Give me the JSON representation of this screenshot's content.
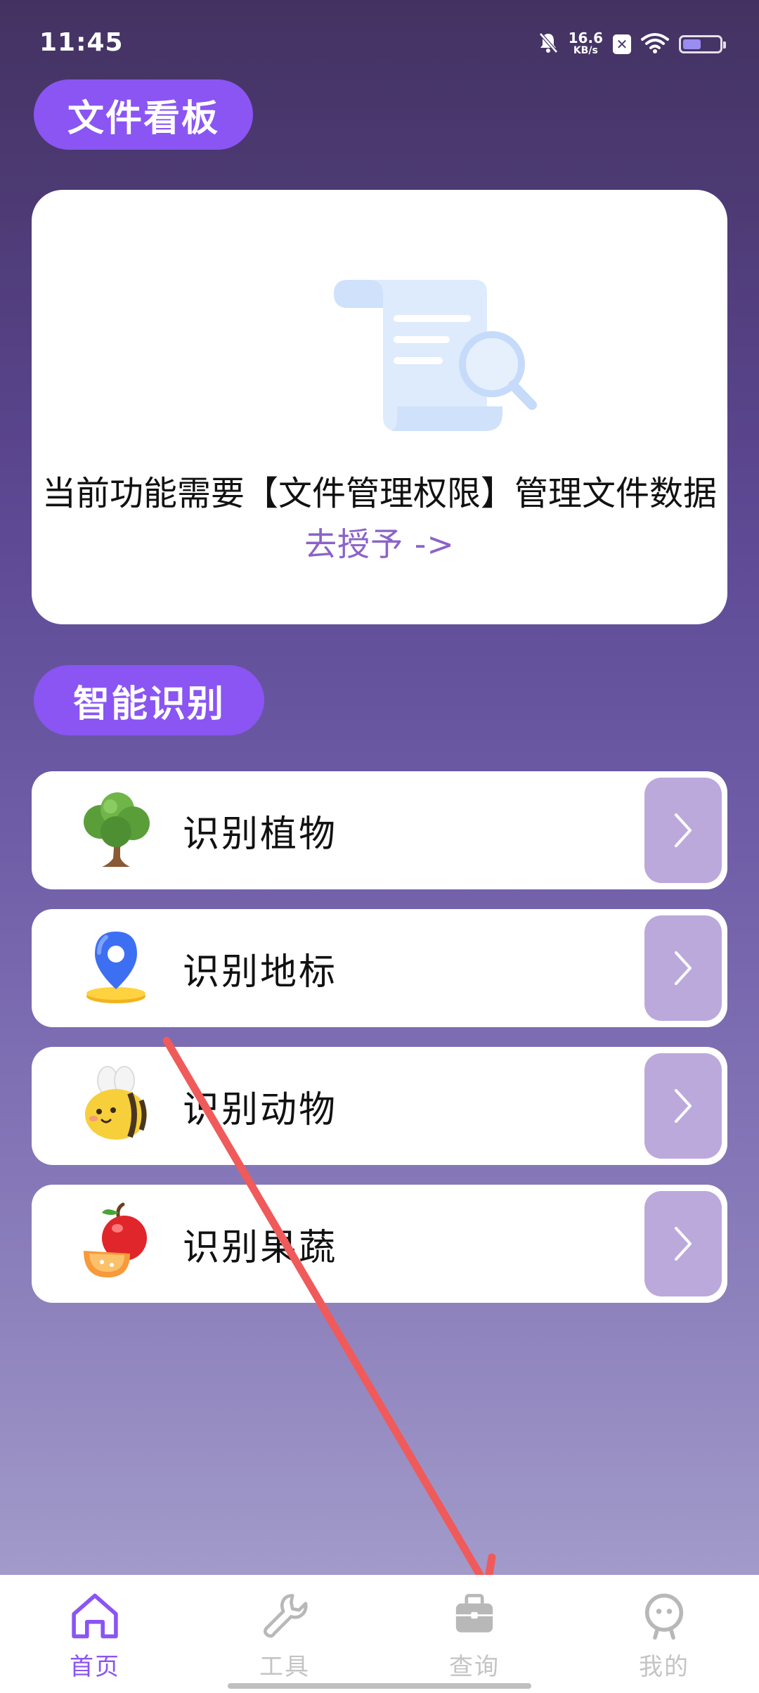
{
  "status_bar": {
    "time": "11:45",
    "net_speed_value": "16.6",
    "net_speed_unit": "KB/s",
    "battery_level": 0.5
  },
  "sections": {
    "file_board_title": "文件看板",
    "smart_recognition_title": "智能识别"
  },
  "permission_card": {
    "message": "当前功能需要【文件管理权限】管理文件数据",
    "action_link": "去授予 ->"
  },
  "recognition_items": [
    {
      "label": "识别植物",
      "icon": "tree-icon"
    },
    {
      "label": "识别地标",
      "icon": "location-pin-icon"
    },
    {
      "label": "识别动物",
      "icon": "bee-icon"
    },
    {
      "label": "识别果蔬",
      "icon": "fruit-icon"
    }
  ],
  "bottom_nav": [
    {
      "label": "首页",
      "icon": "home-icon",
      "active": true
    },
    {
      "label": "工具",
      "icon": "wrench-icon",
      "active": false
    },
    {
      "label": "查询",
      "icon": "briefcase-icon",
      "active": false
    },
    {
      "label": "我的",
      "icon": "profile-icon",
      "active": false
    }
  ],
  "colors": {
    "accent": "#8a55f3",
    "arrow_button": "#bca9db",
    "annotation_arrow": "#f05a5a"
  }
}
